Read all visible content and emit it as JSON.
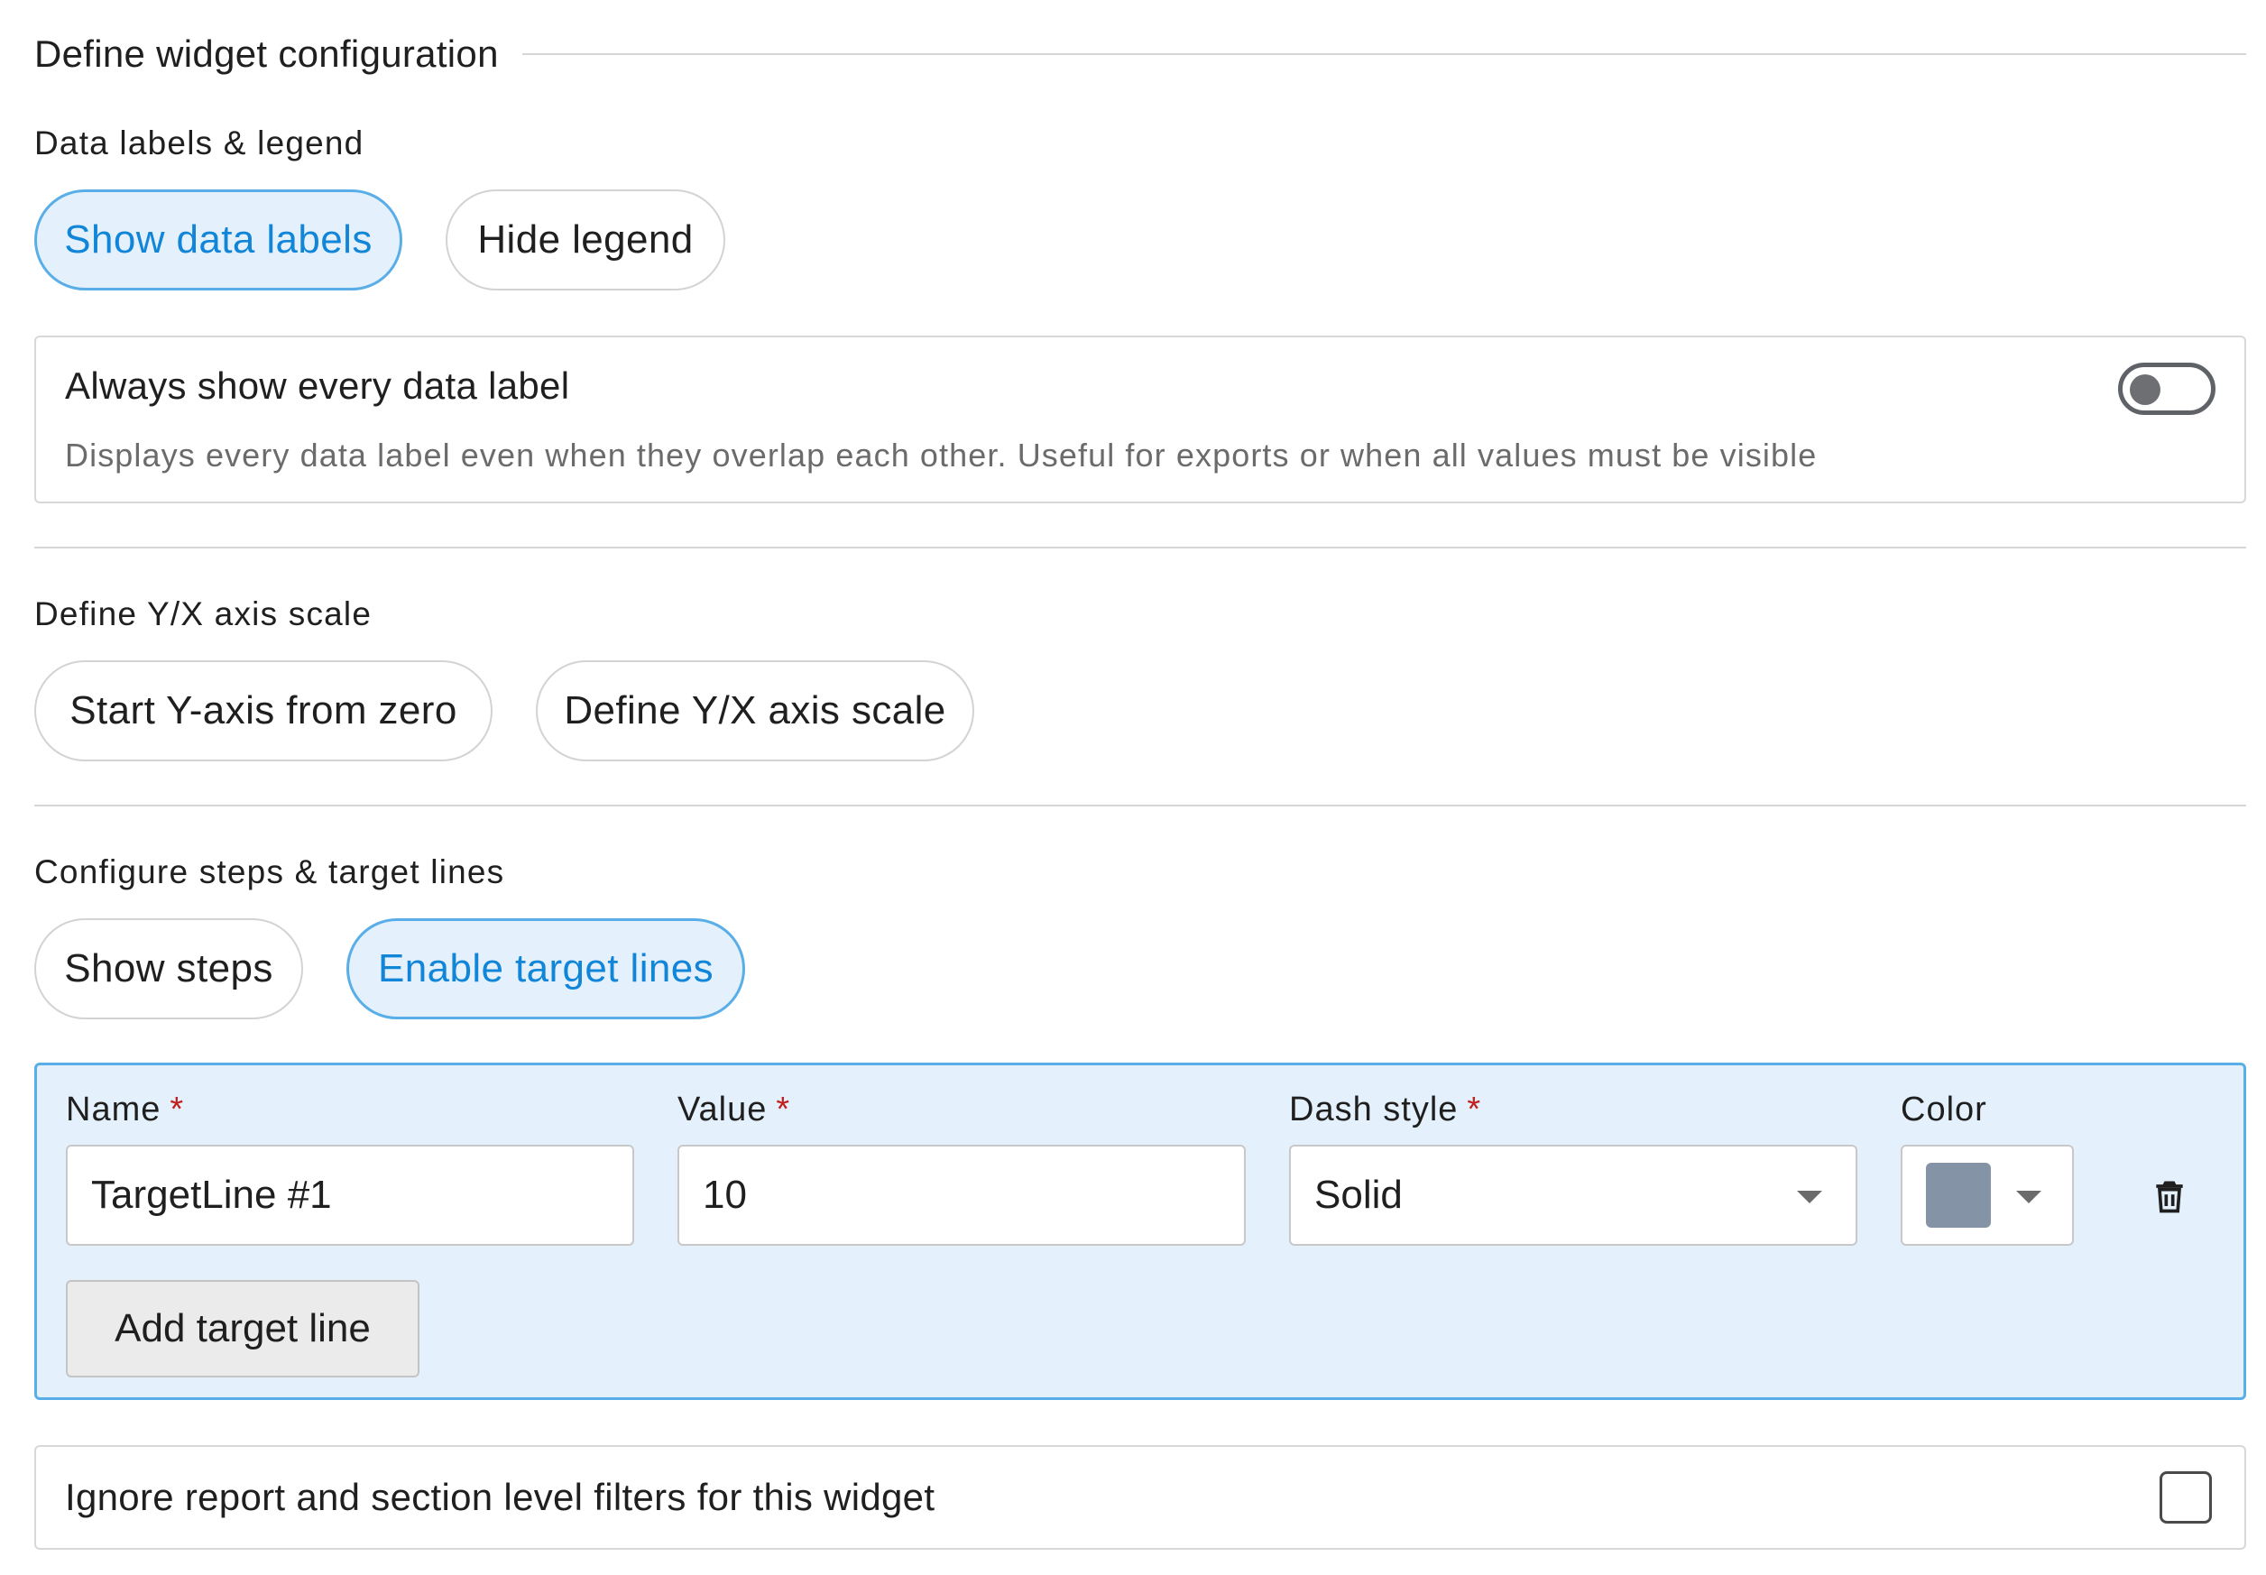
{
  "header": {
    "title": "Define widget configuration"
  },
  "data_labels_section": {
    "label": "Data labels & legend",
    "options": [
      {
        "label": "Show data labels",
        "selected": true
      },
      {
        "label": "Hide legend",
        "selected": false
      }
    ],
    "always_show": {
      "title": "Always show every data label",
      "description": "Displays every data label even when they overlap each other. Useful for exports or when all values must be visible",
      "enabled": false
    }
  },
  "axis_section": {
    "label": "Define Y/X axis scale",
    "options": [
      {
        "label": "Start Y-axis from zero",
        "selected": false
      },
      {
        "label": "Define Y/X axis scale",
        "selected": false
      }
    ]
  },
  "steps_section": {
    "label": "Configure steps & target lines",
    "options": [
      {
        "label": "Show steps",
        "selected": false
      },
      {
        "label": "Enable target lines",
        "selected": true
      }
    ]
  },
  "target_lines": {
    "columns": {
      "name": "Name",
      "value": "Value",
      "dash_style": "Dash style",
      "color": "Color"
    },
    "required_marker": "*",
    "rows": [
      {
        "name": "TargetLine #1",
        "value": "10",
        "dash_style": "Solid",
        "color": "#8593a6"
      }
    ],
    "add_button": "Add target line",
    "delete_icon": "trash-icon"
  },
  "ignore_filters": {
    "label": "Ignore report and section level filters for this widget",
    "checked": false
  },
  "colors": {
    "accent": "#1185d8",
    "accent_bg": "#e4f1fc",
    "accent_border": "#5aaee8",
    "required": "#c21f1f"
  }
}
